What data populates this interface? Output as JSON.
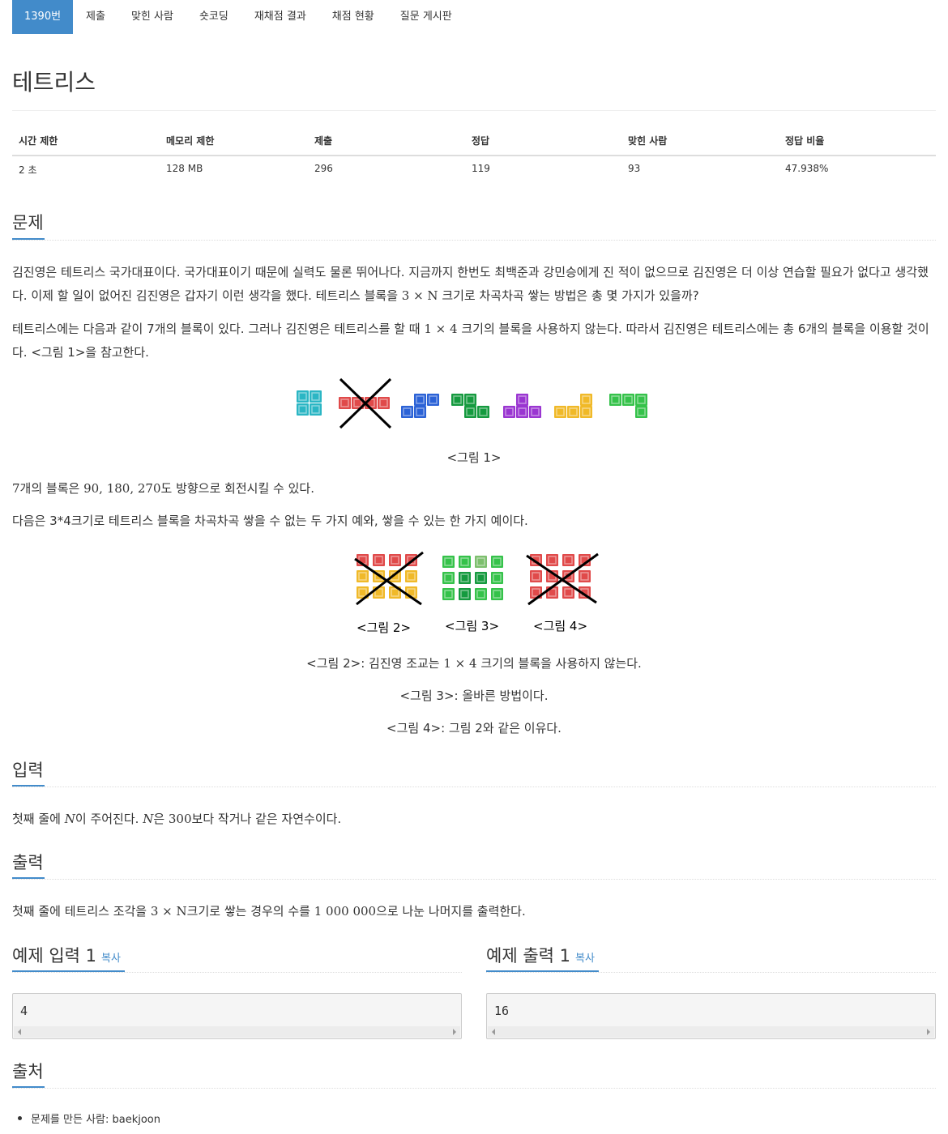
{
  "nav": {
    "tabs": [
      {
        "label": "1390번",
        "active": true
      },
      {
        "label": "제출"
      },
      {
        "label": "맞힌 사람"
      },
      {
        "label": "숏코딩"
      },
      {
        "label": "재채점 결과"
      },
      {
        "label": "채점 현황"
      },
      {
        "label": "질문 게시판"
      }
    ]
  },
  "problem": {
    "title": "테트리스",
    "info_headers": [
      "시간 제한",
      "메모리 제한",
      "제출",
      "정답",
      "맞힌 사람",
      "정답 비율"
    ],
    "info_values": [
      "2 초",
      "128 MB",
      "296",
      "119",
      "93",
      "47.938%"
    ]
  },
  "sections": {
    "problem_title": "문제",
    "input_title": "입력",
    "output_title": "출력",
    "source_title": "출처"
  },
  "description": {
    "p1_a": "김진영은 테트리스 국가대표이다. 국가대표이기 때문에 실력도 물론 뛰어나다. 지금까지 한번도 최백준과 강민승에게 진 적이 없으므로 김진영은 더 이상 연습할 필요가 없다고 생각했다. 이제 할 일이 없어진 김진영은 갑자기 이런 생각을 했다. 테트리스 블록을 ",
    "p1_math": "3 × N",
    "p1_b": " 크기로 차곡차곡 쌓는 방법은 총 몇 가지가 있을까?",
    "p2_a": "테트리스에는 다음과 같이 7개의 블록이 있다. 그러나 김진영은 테트리스를 할 때 ",
    "p2_math": "1 × 4",
    "p2_b": " 크기의 블록을 사용하지 않는다. 따라서 김진영은 테트리스에는 총 6개의 블록을 이용할 것이다. <그림 1>을 참고한다.",
    "fig1_caption": "<그림 1>",
    "p3_math": "7",
    "p3_a": "개의 블록은 ",
    "p3_math2": "90, 180, 270",
    "p3_b": "도 방향으로 회전시킬 수 있다.",
    "p4": "다음은 3*4크기로 테트리스 블록을 차곡차곡 쌓을 수 없는 두 가지 예와, 쌓을 수 있는 한 가지 예이다.",
    "fig_labels": [
      "<그림  2>",
      "<그림  3>",
      "<그림  4>"
    ],
    "cap2_a": "<그림 2>: 김진영 조교는 ",
    "cap2_math": "1 × 4",
    "cap2_b": " 크기의 블록을 사용하지 않는다.",
    "cap3": "<그림 3>: 올바른 방법이다.",
    "cap4": "<그림 4>: 그림 2와 같은 이유다."
  },
  "input": {
    "a": "첫째 줄에 ",
    "m1": "N",
    "b": "이 주어진다. ",
    "m2": "N",
    "c": "은 ",
    "m3": "300",
    "d": "보다 작거나 같은 자연수이다."
  },
  "output": {
    "a": "첫째 줄에 테트리스 조각을 ",
    "m1": "3 × N",
    "b": "크기로 쌓는 경우의 수를 ",
    "m2": "1 000 000",
    "c": "으로 나눈 나머지를 출력한다."
  },
  "samples": {
    "input_title": "예제 입력 1",
    "output_title": "예제 출력 1",
    "copy_label": "복사",
    "input_value": "4",
    "output_value": "16"
  },
  "source": {
    "item": "문제를 만든 사람: baekjoon"
  }
}
